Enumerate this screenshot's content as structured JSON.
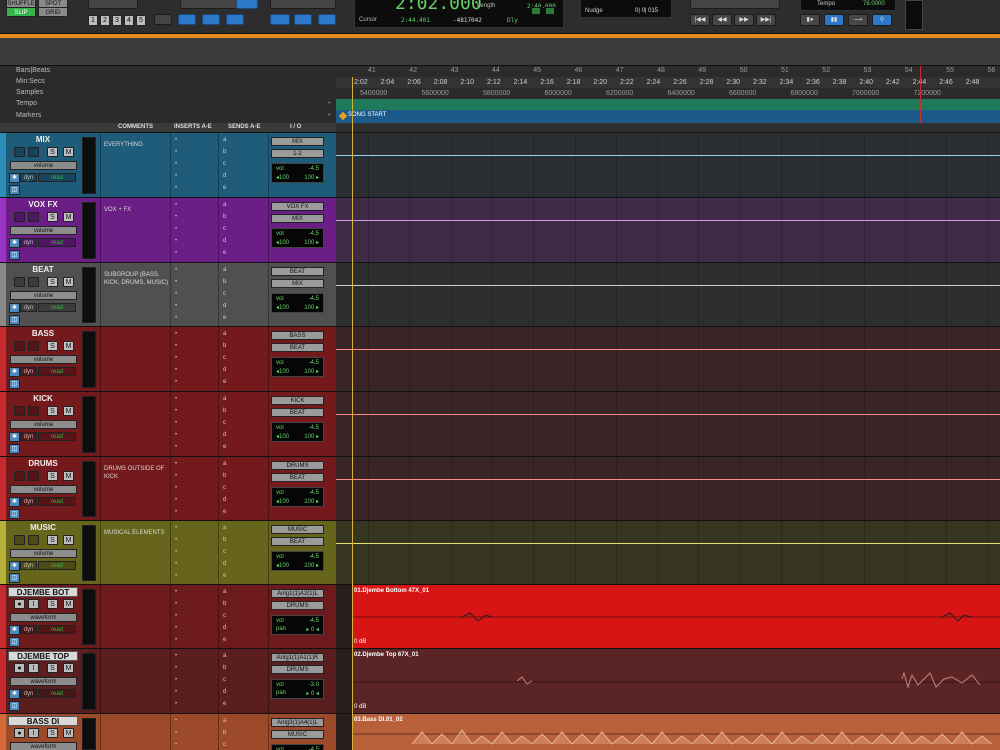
{
  "transport": {
    "edit_modes": [
      "SHUFFLE",
      "SPOT",
      "SLIP",
      "GRID"
    ],
    "zoom_presets": [
      "1",
      "2",
      "3",
      "4",
      "5"
    ],
    "main_counter": "2:02.000",
    "length_label": "Length",
    "length_value": "2:40.000",
    "cursor_label": "Cursor",
    "cursor_value": "2:44.401",
    "sample_value": "-4817042",
    "dly_label": "Dly",
    "nudge_label": "Nudge",
    "nudge_value": "0| 0| 015",
    "tempo_label": "Tempo",
    "tempo_value": "78.0000"
  },
  "rulers": {
    "labels": [
      "Bars|Beats",
      "Min:Secs",
      "Samples",
      "Tempo",
      "Markers"
    ],
    "bars": [
      "41",
      "42",
      "43",
      "44",
      "45",
      "46",
      "47",
      "48",
      "49",
      "50",
      "51",
      "52",
      "53",
      "54",
      "55",
      "56"
    ],
    "minsecs": [
      "2:02",
      "2:04",
      "2:06",
      "2:08",
      "2:10",
      "2:12",
      "2:14",
      "2:16",
      "2:18",
      "2:20",
      "2:22",
      "2:24",
      "2:26",
      "2:28",
      "2:30",
      "2:32",
      "2:34",
      "2:36",
      "2:38",
      "2:40",
      "2:42",
      "2:44",
      "2:46",
      "2:48"
    ],
    "samples": [
      "5400000",
      "5600000",
      "5800000",
      "6000000",
      "6200000",
      "6400000",
      "6600000",
      "6800000",
      "7000000",
      "7200000"
    ],
    "marker": "SONG START"
  },
  "columns": {
    "comments": "COMMENTS",
    "inserts": "INSERTS A-E",
    "sends": "SENDS A-E",
    "io": "I / O"
  },
  "colors": {
    "aux_teal": "#1f5c7a",
    "aux_purple": "#7a1f95",
    "aux_gray": "#5a5a5a",
    "red": "#7d1a1c",
    "olive": "#6e6a1e",
    "bright_red": "#d81515",
    "dark_red": "#5c2222",
    "orange": "#b8603a",
    "record_green": "#35b44a"
  },
  "tracks": [
    {
      "name": "MIX",
      "comment": "EVERYTHING",
      "io_in": "MIX",
      "io_out": "1-2",
      "vol": "-4.5",
      "pan_l": "◂100",
      "pan_r": "100 ▸",
      "view": "volume"
    },
    {
      "name": "VOX FX",
      "comment": "VOX + FX",
      "io_in": "VOX FX",
      "io_out": "MIX",
      "vol": "-4.5",
      "pan_l": "◂100",
      "pan_r": "100 ▸",
      "view": "volume"
    },
    {
      "name": "BEAT",
      "comment": "SUBGROUP (BASS, KICK, DRUMS, MUSIC)",
      "io_in": "BEAT",
      "io_out": "MIX",
      "vol": "-4.5",
      "pan_l": "◂100",
      "pan_r": "100 ▸",
      "view": "volume"
    },
    {
      "name": "BASS",
      "comment": "",
      "io_in": "BASS",
      "io_out": "BEAT",
      "vol": "-4.5",
      "pan_l": "◂100",
      "pan_r": "100 ▸",
      "view": "volume"
    },
    {
      "name": "KICK",
      "comment": "",
      "io_in": "KICK",
      "io_out": "BEAT",
      "vol": "-4.5",
      "pan_l": "◂100",
      "pan_r": "100 ▸",
      "view": "volume"
    },
    {
      "name": "DRUMS",
      "comment": "DRUMS OUTSIDE OF KICK",
      "io_in": "DRUMS",
      "io_out": "BEAT",
      "vol": "-4.5",
      "pan_l": "◂100",
      "pan_r": "100 ▸",
      "view": "volume"
    },
    {
      "name": "MUSIC",
      "comment": "MUSICAL ELEMENTS",
      "io_in": "MUSIC",
      "io_out": "BEAT",
      "vol": "-4.5",
      "pan_l": "◂100",
      "pan_r": "100 ▸",
      "view": "volume"
    },
    {
      "name": "DJEMBE BOT",
      "comment": "",
      "io_in": "Anlg1(1)A2(1)L",
      "io_out": "DRUMS",
      "vol": "-4.5",
      "pan_l": "pan",
      "pan_r": "▸ 0 ◂",
      "view": "waveform",
      "clip": "01.Djembe Bottom 47X_01",
      "clip_gain": "0 dB"
    },
    {
      "name": "DJEMBE TOP",
      "comment": "",
      "io_in": "Anlg1(1)A1(1)R",
      "io_out": "DRUMS",
      "vol": "-3.0",
      "pan_l": "pan",
      "pan_r": "▸ 0 ◂",
      "view": "waveform",
      "clip": "02.Djembe Top 67X_01",
      "clip_gain": "0 dB"
    },
    {
      "name": "BASS DI",
      "comment": "",
      "io_in": "Anlg3(1)A4(1)L",
      "io_out": "MUSIC",
      "vol": "-4.5",
      "pan_l": "pan",
      "pan_r": "▸ 0 ◂",
      "view": "waveform",
      "clip": "03.Bass DI.01_02",
      "clip_gain": ""
    }
  ],
  "button_labels": {
    "solo": "S",
    "mute": "M",
    "input": "I",
    "dyn": "dyn",
    "read": "read",
    "sends": [
      "a",
      "b",
      "c",
      "d",
      "e"
    ]
  }
}
